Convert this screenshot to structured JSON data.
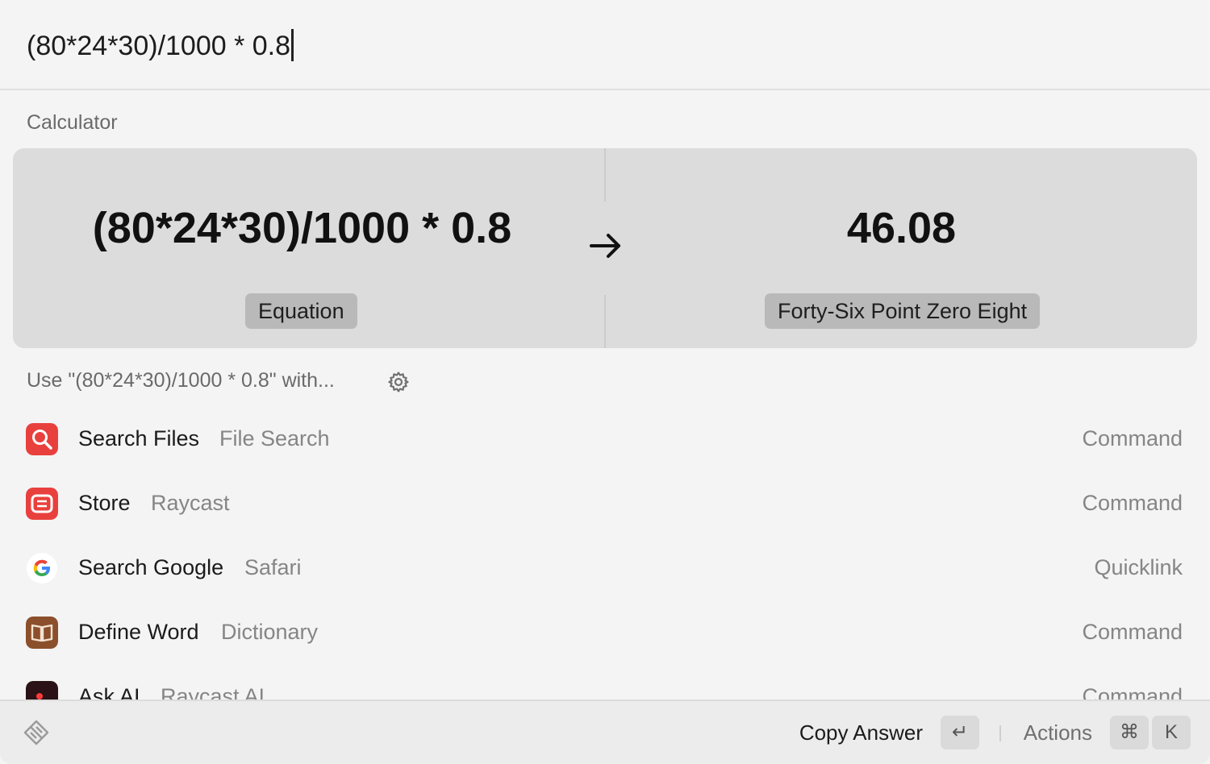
{
  "search": {
    "query": "(80*24*30)/1000 * 0.8"
  },
  "calculator": {
    "section_title": "Calculator",
    "equation": "(80*24*30)/1000 * 0.8",
    "result": "46.08",
    "equation_label": "Equation",
    "result_label": "Forty-Six Point Zero Eight"
  },
  "use_with": {
    "label": "Use \"(80*24*30)/1000 * 0.8\" with..."
  },
  "results": [
    {
      "title": "Search Files",
      "subtitle": "File Search",
      "type": "Command",
      "icon": "search-files-icon",
      "color": "#e8413d"
    },
    {
      "title": "Store",
      "subtitle": "Raycast",
      "type": "Command",
      "icon": "raycast-store-icon",
      "color": "#e8413d"
    },
    {
      "title": "Search Google",
      "subtitle": "Safari",
      "type": "Quicklink",
      "icon": "google-icon",
      "color": "#ffffff"
    },
    {
      "title": "Define Word",
      "subtitle": "Dictionary",
      "type": "Command",
      "icon": "dictionary-icon",
      "color": "#8c4f2c"
    },
    {
      "title": "Ask AI",
      "subtitle": "Raycast AI",
      "type": "Command",
      "icon": "raycast-ai-icon",
      "color": "#2a1216"
    }
  ],
  "footer": {
    "primary_action": "Copy Answer",
    "enter_key": "↵",
    "actions_label": "Actions",
    "cmd_key": "⌘",
    "k_key": "K"
  }
}
